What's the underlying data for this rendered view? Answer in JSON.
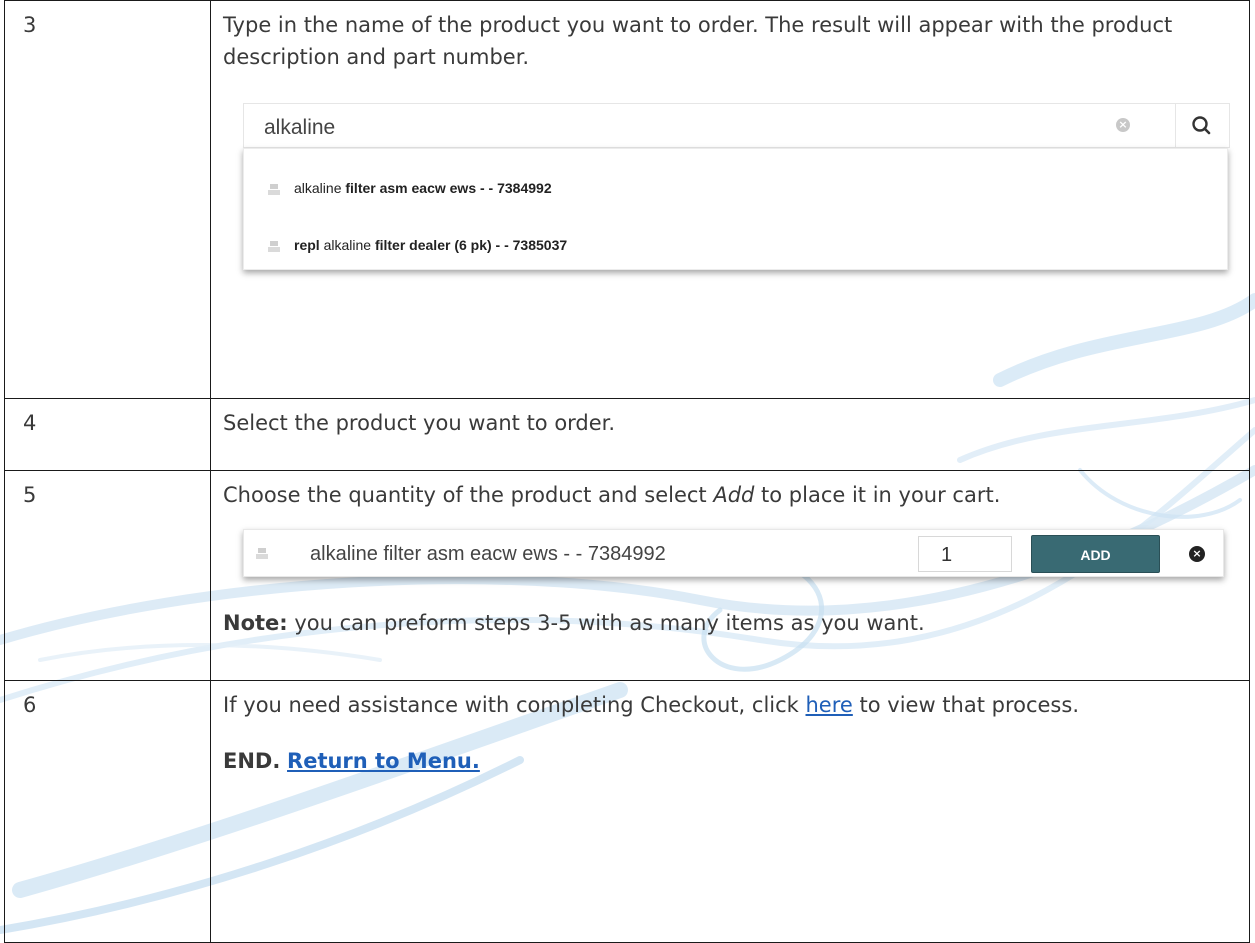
{
  "steps": [
    {
      "number": "3",
      "text": "Type in the name of the product you want to order. The result will appear with the product description and part number."
    },
    {
      "number": "4",
      "text": "Select the product you want to order."
    },
    {
      "number": "5",
      "text_before": "Choose the quantity of the product and select ",
      "text_emph": "Add",
      "text_after": " to place it in your cart.",
      "note_label": "Note:",
      "note_text": " you can preform steps 3-5 with as many items as you want."
    },
    {
      "number": "6",
      "text_before": "If you need assistance with completing Checkout, click ",
      "link_text": "here",
      "text_after": " to view that process.",
      "end_label": "END.",
      "end_link": "Return to Menu."
    }
  ],
  "search": {
    "value": "alkaline",
    "clear_icon": "clear-icon",
    "search_icon": "search-icon",
    "results": [
      {
        "pre": "",
        "match": "alkaline",
        "post": " filter asm eacw ews - - 7384992"
      },
      {
        "pre": "repl ",
        "match": "alkaline",
        "post": " filter dealer (6 pk) - - 7385037"
      }
    ]
  },
  "add_row": {
    "item": "alkaline filter asm eacw ews - - 7384992",
    "quantity": "1",
    "add_label": "ADD",
    "remove_icon": "remove-icon"
  }
}
